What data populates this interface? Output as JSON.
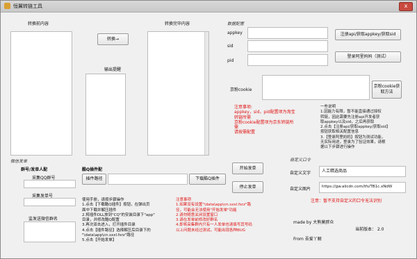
{
  "window": {
    "title": "恒翼转链工具",
    "close_label": "x"
  },
  "convert": {
    "before_label": "转换前内容",
    "after_label": "转换完毕内容",
    "convert_button": "转换→",
    "output_label": "输出提醒"
  },
  "data_config": {
    "header": "数据配置",
    "appkey_label": "appkey",
    "sid_label": "sid",
    "pid_label": "pid",
    "register_button": "注册api/获取appkey/获取sid",
    "login_button": "登录阿里妈妈（测试）",
    "jd_cookie_label": "京粉cookie",
    "jd_cookie_button": "京粉cookie获取方法",
    "notes_red": "注意事项:\nappkey，sid，pid配置项为淘宝\n转链所需\n京粉cookie配置项为京东转链所\n需\n请按需配置",
    "instructions": "一些说明\n1.因能力有限，暂不能直接通过授权\n转链，因此需要先注册api开发者获\n取appkey以及sid，之后再获取\n2.点击【注册api/获取appkey/获取sid】\n按钮获取相关配置信息\n3.【登录阿里妈妈】按钮为测试功能，\n无实际用途，登录为了验证效果，请根\n据以下步骤进行操作"
  },
  "wechat": {
    "header": "微信发单",
    "group_col": "群号/发单人配",
    "qq_group_label": "采集QQ群号",
    "sender_label": "采集发单号",
    "wechat_group_label": "监发送微信群名",
    "collect_header": "酷Q插件配",
    "plugin_path_button": "插件路径",
    "download_button": "下载酷Q插件",
    "start_button": "开始发单",
    "stop_button": "停止发单",
    "manual": "使用手册，请按步骤操作\n1.点击【下载酷Q插件】按钮，在弹出页\n面中下载并解压插件\n2.将插件DLL放到\"CQ\"的安装目录下\"app\"\n目录，并修改酷Q配置\n3.再次双击进入，打开插件目录\n4.点击【插件路径】选择解压后目录下的\n\"\\data\\app\\cn.sxxl.fsrz\"路径\n5.点击【开始发单】",
    "notes_red": "注意事项\n1.如果没有设置\"\\data\\app\\cn.sxxl.fsrz\"路\n径，可能会无法使用\"开始发单\"功能\n2.请勿随意关闭设置窗口\n3.请在发单前修改好群名\n4.即将采集群内只有一人发单也请填写其号码\n以上问题未经过测试，可能出现各种BUG"
  },
  "custom_cmd": {
    "header": "自定义口令",
    "text_label": "自定义文字",
    "text_value": "人工精选商品",
    "image_label": "自定义图片",
    "image_value": "https://gw.alicdn.com/tfs/TB1c.xNdW",
    "note_red": "注意：暂不支持自定义的口令无法识别",
    "made_by": "made by 大熊莫胖众",
    "version": "当前版本： 2.0",
    "from": "From 吾爱丫解"
  }
}
